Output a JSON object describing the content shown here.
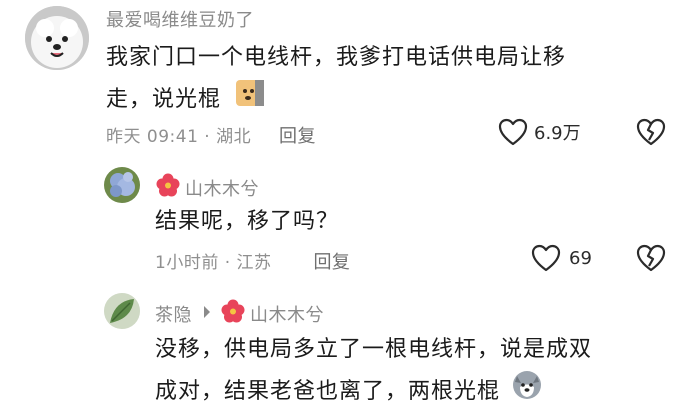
{
  "comments": [
    {
      "author": "最爱喝维维豆奶了",
      "content_line1": "我家门口一个电线杆，我爹打电话供电局让移",
      "content_line2": "走，说光棍",
      "time": "昨天 09:41 · 湖北",
      "reply_label": "回复",
      "like_count": "6.9万"
    },
    {
      "author": "山木木兮",
      "content": "结果呢，移了吗？",
      "time": "1小时前 · 江苏",
      "reply_label": "回复",
      "like_count": "69"
    },
    {
      "author": "茶隐",
      "reply_to": "山木木兮",
      "content_line1": "没移，供电局多立了一根电线杆，说是成双",
      "content_line2": "成对，结果老爸也离了，两根光棍"
    }
  ],
  "colors": {
    "muted_text": "#8a8a8a",
    "body_text": "#1b1b1b",
    "flower_badge": "#e8445a"
  },
  "icons": [
    "heart-outline-icon",
    "broken-heart-icon",
    "flower-badge-icon",
    "doge-emoji",
    "husky-emoji"
  ]
}
